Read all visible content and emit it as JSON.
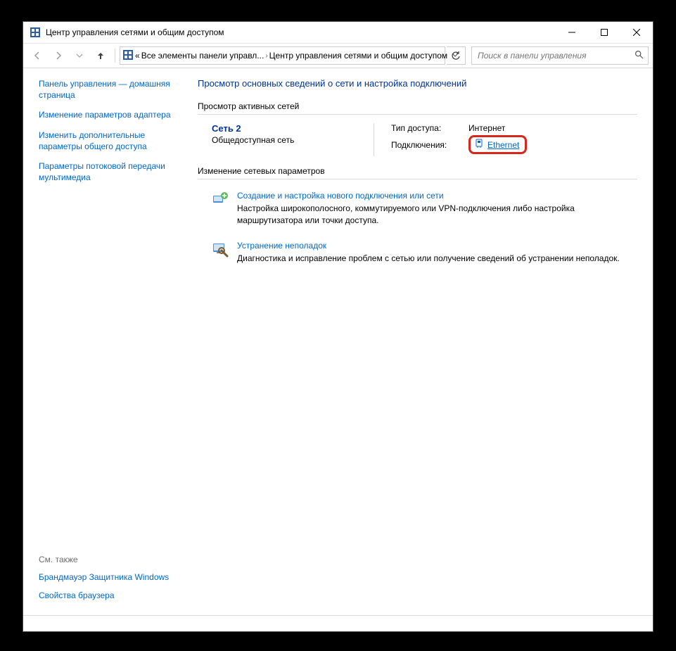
{
  "window": {
    "title": "Центр управления сетями и общим доступом"
  },
  "toolbar": {
    "crumb_prefix": "«",
    "crumb1": "Все элементы панели управл...",
    "crumb2": "Центр управления сетями и общим доступом",
    "search_placeholder": "Поиск в панели управления"
  },
  "sidebar": {
    "home": "Панель управления — домашняя страница",
    "link1": "Изменение параметров адаптера",
    "link2": "Изменить дополнительные параметры общего доступа",
    "link3": "Параметры потоковой передачи мультимедиа",
    "also_title": "См. также",
    "also1": "Брандмауэр Защитника Windows",
    "also2": "Свойства браузера"
  },
  "content": {
    "heading": "Просмотр основных сведений о сети и настройка подключений",
    "group1_title": "Просмотр активных сетей",
    "group2_title": "Изменение сетевых параметров",
    "network": {
      "name": "Сеть 2",
      "type": "Общедоступная сеть",
      "access_label": "Тип доступа:",
      "access_value": "Интернет",
      "conn_label": "Подключения:",
      "conn_value": "Ethernet"
    },
    "task1": {
      "link": "Создание и настройка нового подключения или сети",
      "desc": "Настройка широкополосного, коммутируемого или VPN-подключения либо настройка маршрутизатора или точки доступа."
    },
    "task2": {
      "link": "Устранение неполадок",
      "desc": "Диагностика и исправление проблем с сетью или получение сведений об устранении неполадок."
    }
  }
}
